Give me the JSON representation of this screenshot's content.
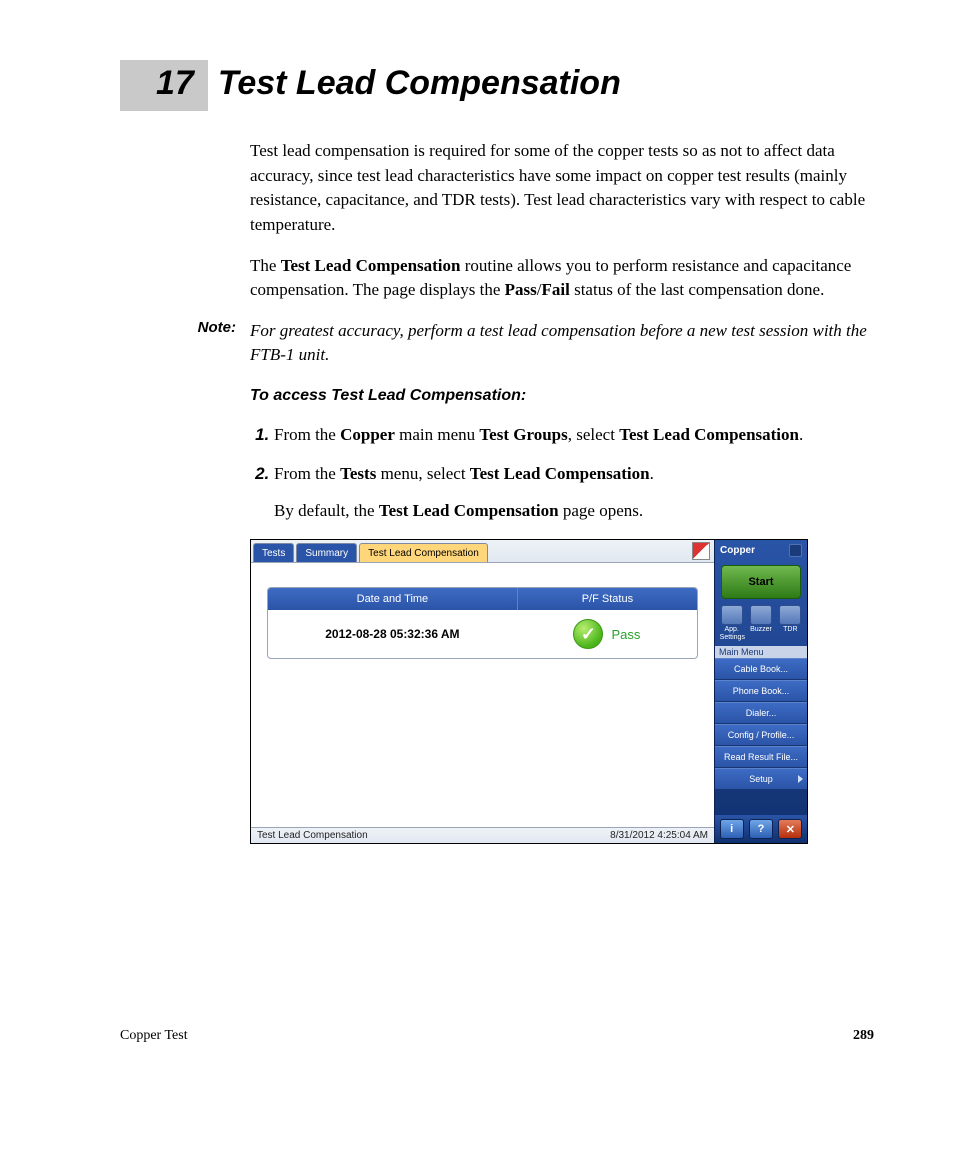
{
  "chapter": {
    "number": "17",
    "title": "Test Lead Compensation"
  },
  "para1": "Test lead compensation is required for some of the copper tests so as not to affect data accuracy, since test lead characteristics have some impact on copper test results (mainly resistance, capacitance, and TDR tests). Test lead characteristics vary with respect to cable temperature.",
  "para2_pre": "The ",
  "para2_b1": "Test Lead Compensation",
  "para2_mid": " routine allows you to perform resistance and capacitance compensation. The page displays the ",
  "para2_b2": "Pass",
  "para2_slash": "/",
  "para2_b3": "Fail",
  "para2_post": " status of the last compensation done.",
  "note": {
    "label": "Note:",
    "body": "For greatest accuracy, perform a test lead compensation before a new test session with the FTB-1 unit."
  },
  "subhead": "To access Test Lead Compensation:",
  "steps": {
    "s1_pre": "From the ",
    "s1_b1": "Copper",
    "s1_mid1": " main menu ",
    "s1_b2": "Test Groups",
    "s1_mid2": ", select ",
    "s1_b3": "Test Lead Compensation",
    "s1_post": ".",
    "s2_pre": "From the ",
    "s2_b1": "Tests",
    "s2_mid": " menu, select ",
    "s2_b2": "Test Lead Compensation",
    "s2_post": ".",
    "s2_after_pre": "By default, the ",
    "s2_after_b": "Test Lead Compensation",
    "s2_after_post": " page opens."
  },
  "screenshot": {
    "tabs": {
      "tests": "Tests",
      "summary": "Summary",
      "active": "Test Lead Compensation"
    },
    "table": {
      "h_date": "Date and Time",
      "h_pf": "P/F Status",
      "datetime": "2012-08-28 05:32:36 AM",
      "status": "Pass"
    },
    "statusbar": {
      "left": "Test Lead Compensation",
      "right": "8/31/2012 4:25:04 AM"
    },
    "side": {
      "title": "Copper",
      "start": "Start",
      "icons": {
        "app": "App. Settings",
        "buzzer": "Buzzer",
        "tdr": "TDR"
      },
      "menu_header": "Main Menu",
      "items": [
        "Cable Book...",
        "Phone Book...",
        "Dialer...",
        "Config / Profile...",
        "Read Result File...",
        "Setup"
      ]
    }
  },
  "footer": {
    "left": "Copper Test",
    "right": "289"
  }
}
